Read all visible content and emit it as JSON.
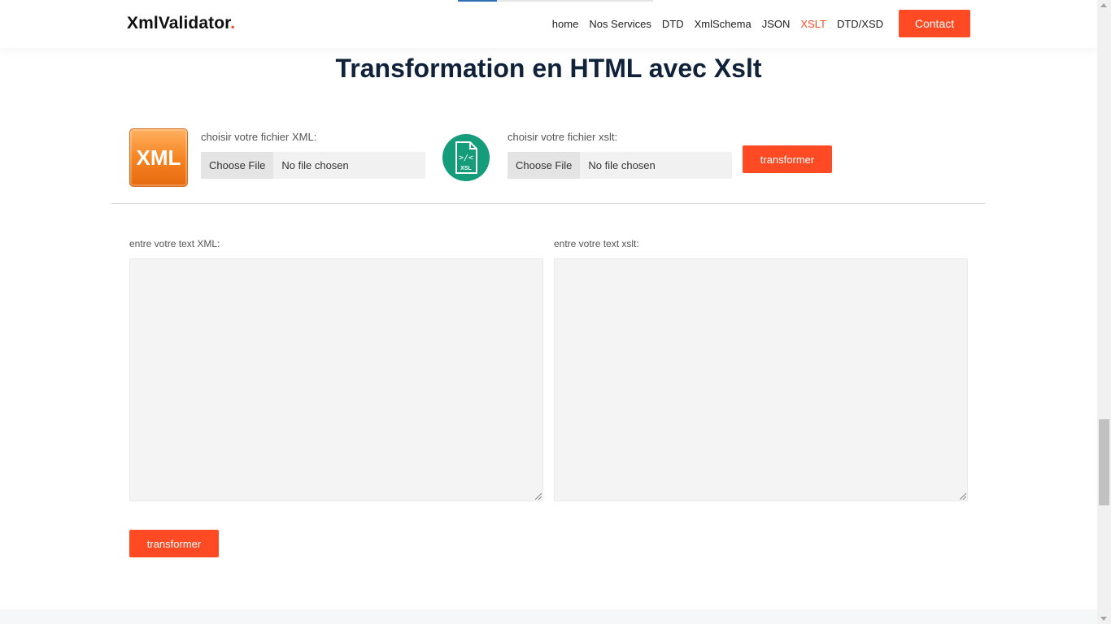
{
  "header": {
    "logo_text": "XmlValidator",
    "logo_dot": ".",
    "nav": [
      {
        "label": "home",
        "active": false
      },
      {
        "label": "Nos Services",
        "active": false
      },
      {
        "label": "DTD",
        "active": false
      },
      {
        "label": "XmlSchema",
        "active": false
      },
      {
        "label": "JSON",
        "active": false
      },
      {
        "label": "XSLT",
        "active": true
      },
      {
        "label": "DTD/XSD",
        "active": false
      }
    ],
    "contact_label": "Contact"
  },
  "main": {
    "title": "Transformation en HTML avec Xslt",
    "xml_icon_text": "XML",
    "xsl_icon_text": "XSL",
    "xml_file_label": "choisir votre fichier XML:",
    "xslt_file_label": "choisir votre fichier xslt:",
    "choose_file_label": "Choose File",
    "no_file_text": "No file chosen",
    "transform_label": "transformer",
    "xml_text_label": "entre votre text XML:",
    "xslt_text_label": "entre votre text xslt:",
    "xml_text_value": "",
    "xslt_text_value": ""
  },
  "colors": {
    "accent": "#ff4a24",
    "title": "#10213a",
    "xsl_icon": "#159c7b",
    "xml_icon": "#f58220"
  },
  "scroll_position": 0.75
}
